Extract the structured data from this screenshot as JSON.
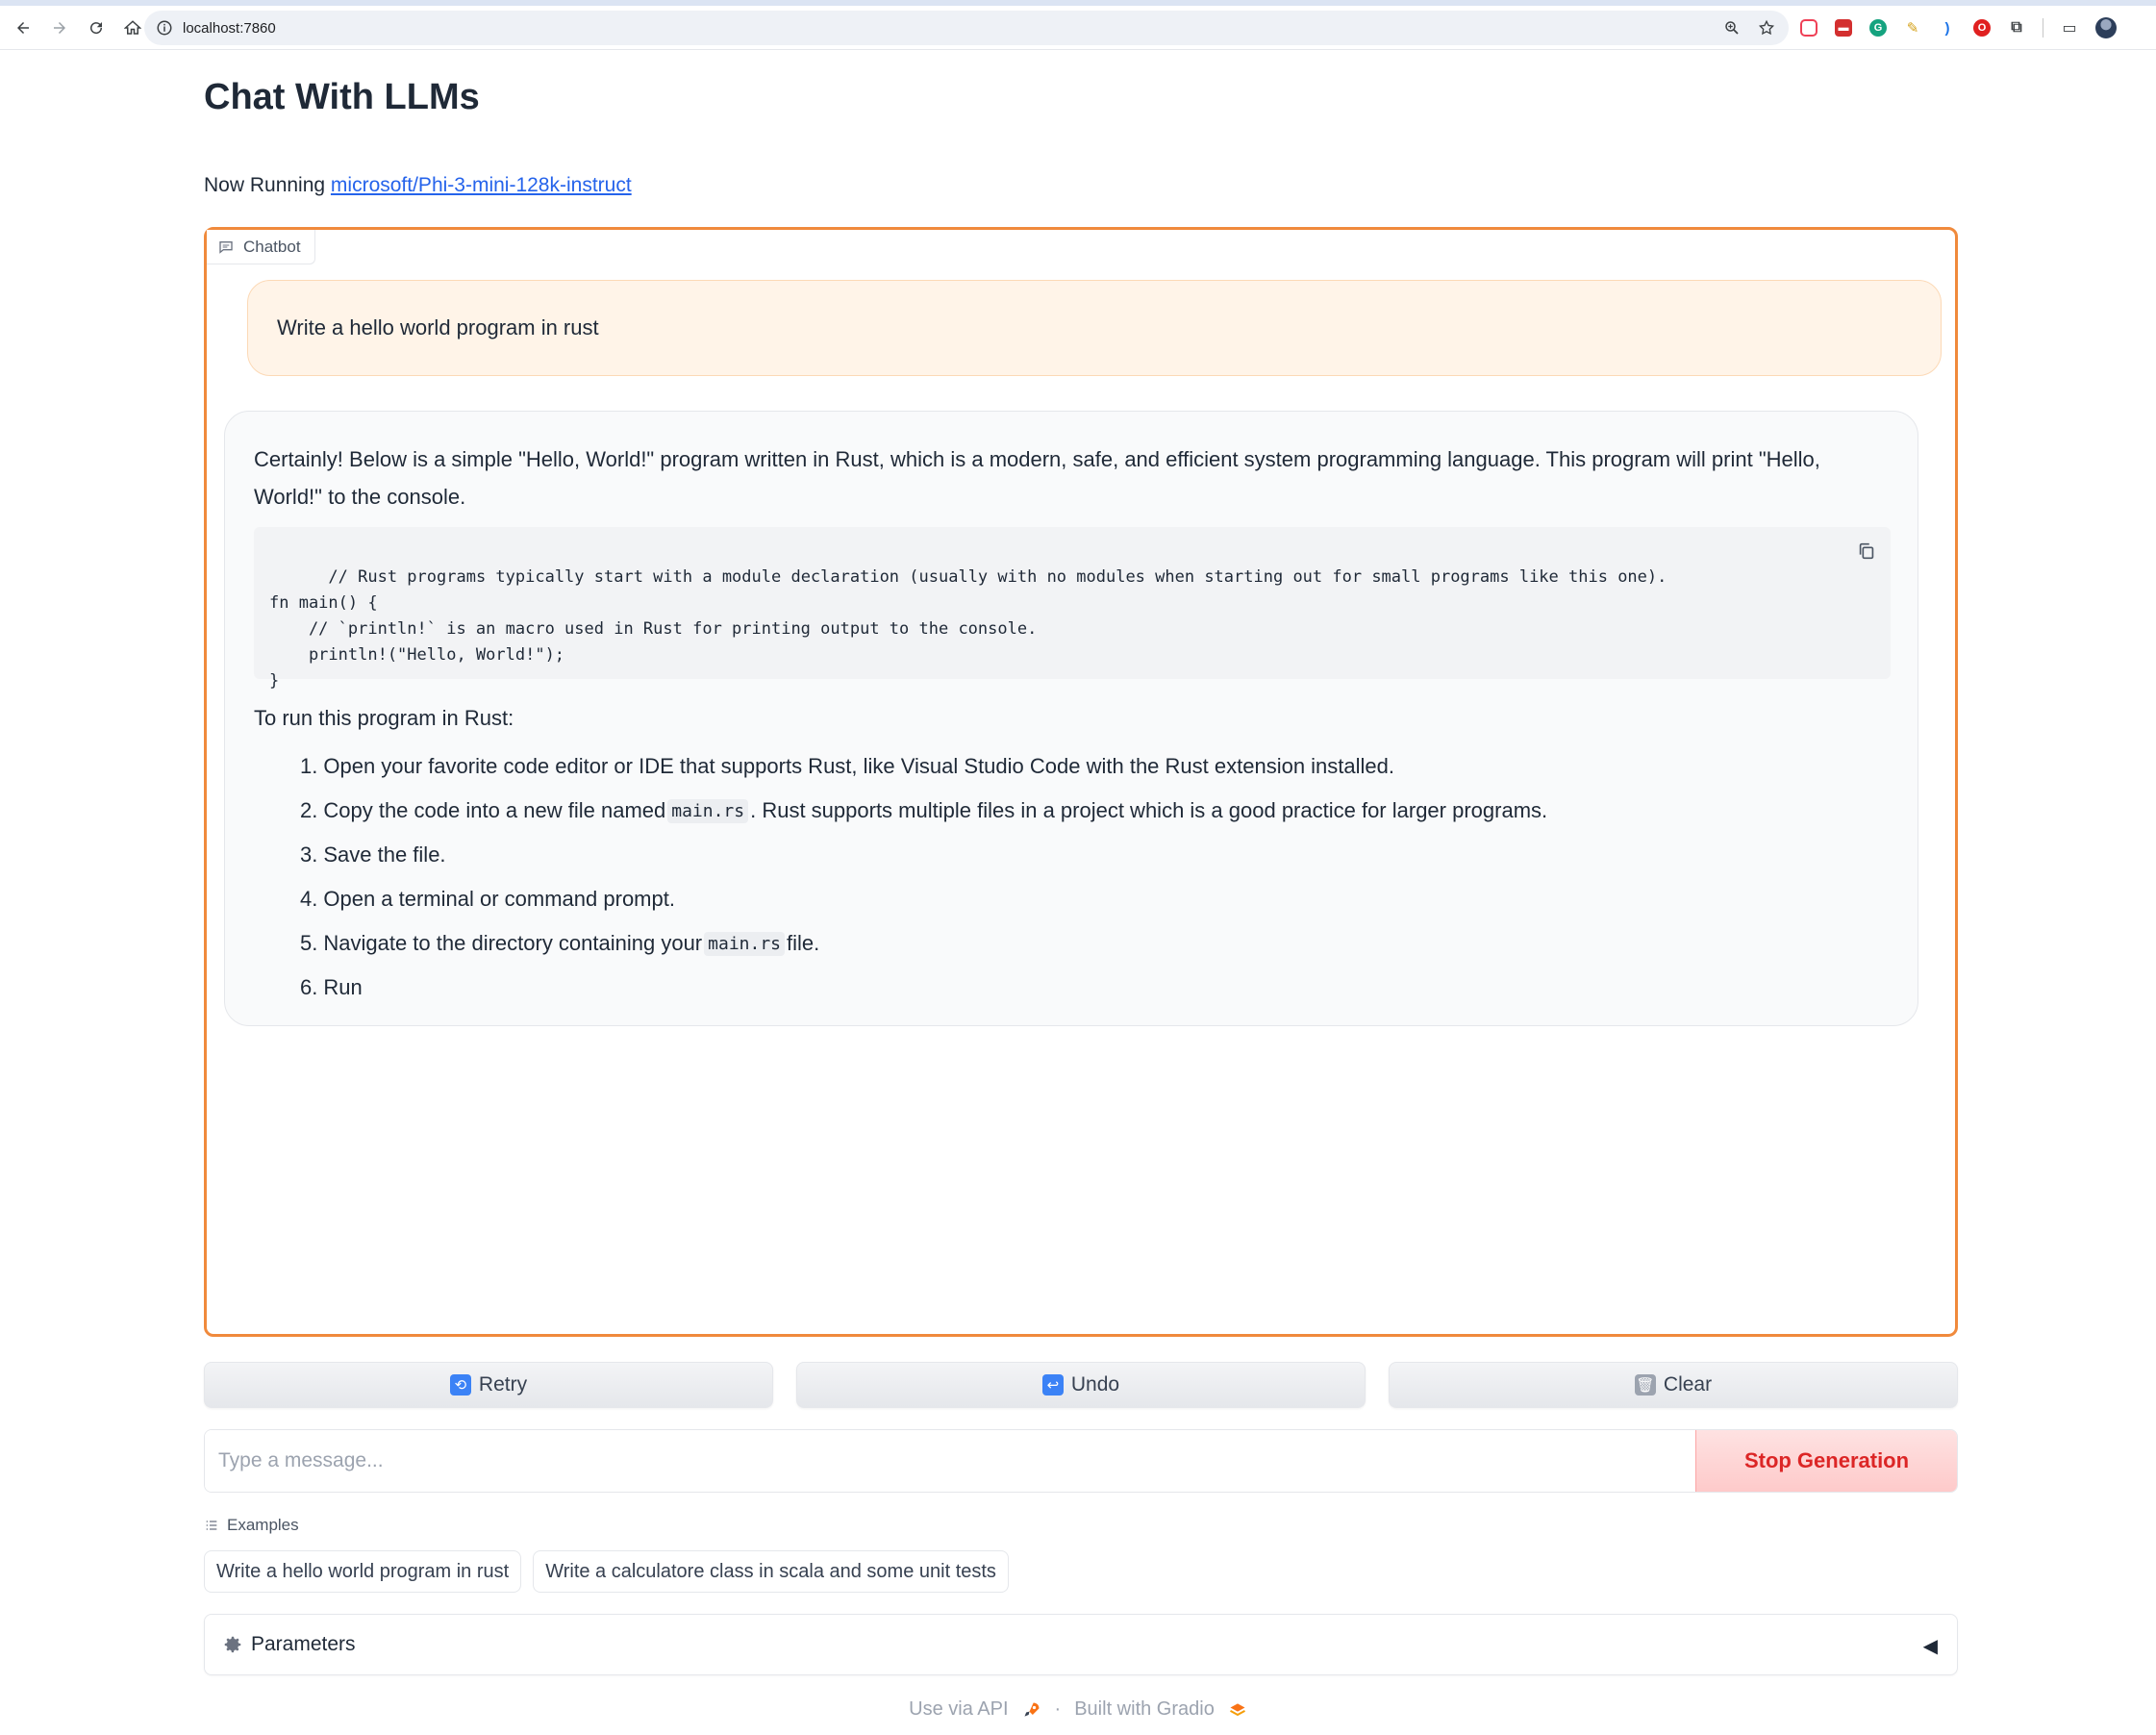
{
  "browser": {
    "url": "localhost:7860"
  },
  "page": {
    "title": "Chat With LLMs",
    "running_prefix": "Now Running",
    "model_link": "microsoft/Phi-3-mini-128k-instruct"
  },
  "chatbot": {
    "label": "Chatbot",
    "user_message": "Write a hello world program in rust",
    "bot_intro": "Certainly! Below is a simple \"Hello, World!\" program written in Rust, which is a modern, safe, and efficient system programming language. This program will print \"Hello, World!\" to the console.",
    "code": "// Rust programs typically start with a module declaration (usually with no modules when starting out for small programs like this one).\nfn main() {\n    // `println!` is an macro used in Rust for printing output to the console.\n    println!(\"Hello, World!\");\n}",
    "run_heading": "To run this program in Rust:",
    "steps": [
      {
        "num": "1.",
        "before": "Open your favorite code editor or IDE that supports Rust, like Visual Studio Code with the Rust extension installed.",
        "code": "",
        "after": ""
      },
      {
        "num": "2.",
        "before": "Copy the code into a new file named",
        "code": "main.rs",
        "after": ". Rust supports multiple files in a project which is a good practice for larger programs."
      },
      {
        "num": "3.",
        "before": "Save the file.",
        "code": "",
        "after": ""
      },
      {
        "num": "4.",
        "before": "Open a terminal or command prompt.",
        "code": "",
        "after": ""
      },
      {
        "num": "5.",
        "before": "Navigate to the directory containing your",
        "code": "main.rs",
        "after": "file."
      },
      {
        "num": "6.",
        "before": "Run",
        "code": "",
        "after": ""
      }
    ]
  },
  "actions": {
    "retry": "Retry",
    "undo": "Undo",
    "clear": "Clear"
  },
  "input": {
    "placeholder": "Type a message...",
    "value": "",
    "stop_label": "Stop Generation"
  },
  "examples": {
    "label": "Examples",
    "items": [
      "Write a hello world program in rust",
      "Write a calculatore class in scala and some unit tests"
    ]
  },
  "parameters": {
    "label": "Parameters",
    "toggle": "◀"
  },
  "footer": {
    "api": "Use via API",
    "separator": "·",
    "built": "Built with Gradio"
  },
  "colors": {
    "accent_border": "#f08a3c",
    "user_bubble": "#fff4e8",
    "stop_text": "#dc2626",
    "link": "#2563eb"
  }
}
